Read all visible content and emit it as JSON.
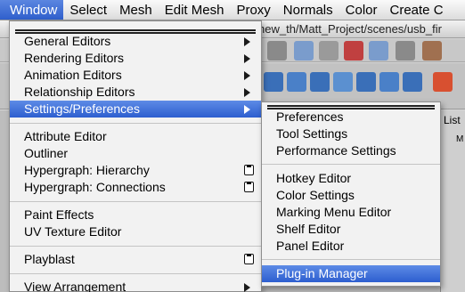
{
  "menubar": {
    "items": [
      "Window",
      "Select",
      "Mesh",
      "Edit Mesh",
      "Proxy",
      "Normals",
      "Color",
      "Create C"
    ],
    "active": "Window"
  },
  "background": {
    "title_fragment": "hew_th/Matt_Project/scenes/usb_fir",
    "list_tab": "List",
    "panel_letter": "M"
  },
  "window_menu": {
    "items": [
      {
        "label": "General Editors",
        "submenu": true
      },
      {
        "label": "Rendering Editors",
        "submenu": true
      },
      {
        "label": "Animation Editors",
        "submenu": true
      },
      {
        "label": "Relationship Editors",
        "submenu": true
      },
      {
        "label": "Settings/Preferences",
        "submenu": true,
        "highlighted": true
      },
      {
        "label": "Attribute Editor"
      },
      {
        "label": "Outliner"
      },
      {
        "label": "Hypergraph: Hierarchy",
        "option_box": true
      },
      {
        "label": "Hypergraph: Connections",
        "option_box": true
      },
      {
        "label": "Paint Effects"
      },
      {
        "label": "UV Texture Editor"
      },
      {
        "label": "Playblast",
        "option_box": true
      },
      {
        "label": "View Arrangement",
        "submenu": true
      }
    ]
  },
  "settings_submenu": {
    "items": [
      {
        "label": "Preferences"
      },
      {
        "label": "Tool Settings"
      },
      {
        "label": "Performance Settings"
      },
      {
        "label": "Hotkey Editor"
      },
      {
        "label": "Color Settings"
      },
      {
        "label": "Marking Menu Editor"
      },
      {
        "label": "Shelf Editor"
      },
      {
        "label": "Panel Editor"
      },
      {
        "label": "Plug-in Manager",
        "highlighted": true
      }
    ]
  },
  "colors": {
    "highlight": "#2f5fcc",
    "menu_bg": "#f2f2f2",
    "menubar_bg": "#e6e6e6"
  },
  "icons": [
    "tear-off-icon",
    "submenu-arrow-icon",
    "option-box-icon"
  ]
}
